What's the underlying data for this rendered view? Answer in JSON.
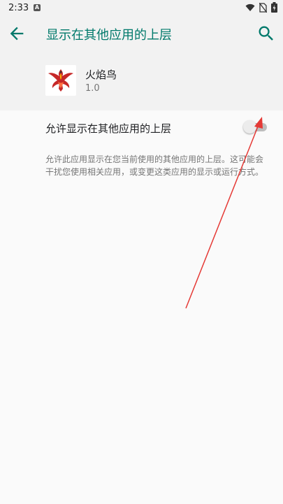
{
  "status_bar": {
    "time": "2:33",
    "notification_letter": "A",
    "icons": [
      "wifi-icon",
      "no-sim-icon",
      "battery-charging-icon"
    ]
  },
  "app_bar": {
    "title": "显示在其他应用的上层",
    "back_icon": "arrow-back-icon",
    "search_icon": "search-icon"
  },
  "app_info": {
    "name": "火焰鸟",
    "version": "1.0",
    "icon": "phoenix-app-icon"
  },
  "setting": {
    "label": "允许显示在其他应用的上层",
    "enabled": false
  },
  "description": "允许此应用显示在您当前使用的其他应用的上层。这可能会干扰您使用相关应用，或变更这类应用的显示或运行方式。",
  "colors": {
    "accent": "#00796b",
    "annotation_arrow": "#e53935"
  }
}
